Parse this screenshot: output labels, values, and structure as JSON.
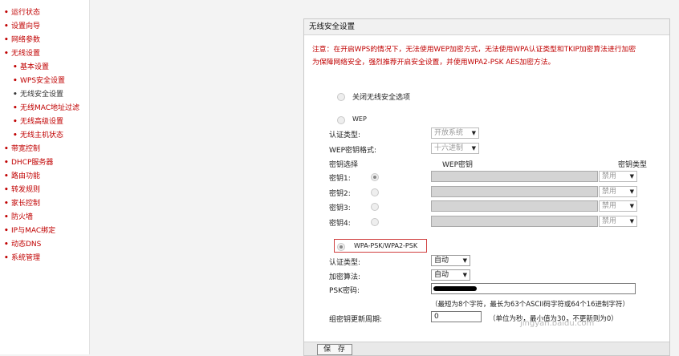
{
  "sidebar": {
    "items": [
      {
        "label": "运行状态",
        "level": "top"
      },
      {
        "label": "设置向导",
        "level": "top"
      },
      {
        "label": "网络参数",
        "level": "top"
      },
      {
        "label": "无线设置",
        "level": "top"
      },
      {
        "label": "基本设置",
        "level": "sub"
      },
      {
        "label": "WPS安全设置",
        "level": "sub"
      },
      {
        "label": "无线安全设置",
        "level": "sub",
        "active": true
      },
      {
        "label": "无线MAC地址过滤",
        "level": "sub"
      },
      {
        "label": "无线高级设置",
        "level": "sub"
      },
      {
        "label": "无线主机状态",
        "level": "sub"
      },
      {
        "label": "带宽控制",
        "level": "top"
      },
      {
        "label": "DHCP服务器",
        "level": "top"
      },
      {
        "label": "路由功能",
        "level": "top"
      },
      {
        "label": "转发规则",
        "level": "top"
      },
      {
        "label": "家长控制",
        "level": "top"
      },
      {
        "label": "防火墙",
        "level": "top"
      },
      {
        "label": "IP与MAC绑定",
        "level": "top"
      },
      {
        "label": "动态DNS",
        "level": "top"
      },
      {
        "label": "系统管理",
        "level": "top"
      }
    ]
  },
  "panel": {
    "title": "无线安全设置",
    "notice_line1": "注意：在开启WPS的情况下，无法使用WEP加密方式，无法使用WPA认证类型和TKIP加密算法进行加密",
    "notice_line2": "为保障网络安全，强烈推荐开启安全设置，并使用WPA2-PSK AES加密方法。"
  },
  "off_option": {
    "label": "关闭无线安全选项"
  },
  "wep": {
    "label": "WEP",
    "auth_label": "认证类型:",
    "auth_value": "开放系统",
    "format_label": "WEP密钥格式:",
    "format_value": "十六进制",
    "key_select_header": "密钥选择",
    "key_header": "WEP密钥",
    "key_type_header": "密钥类型",
    "keys": [
      {
        "label": "密钥1:",
        "type": "禁用"
      },
      {
        "label": "密钥2:",
        "type": "禁用"
      },
      {
        "label": "密钥3:",
        "type": "禁用"
      },
      {
        "label": "密钥4:",
        "type": "禁用"
      }
    ]
  },
  "wpa": {
    "label": "WPA-PSK/WPA2-PSK",
    "auth_label": "认证类型:",
    "auth_value": "自动",
    "alg_label": "加密算法:",
    "alg_value": "自动",
    "psk_label": "PSK密码:",
    "psk_hint": "（最短为8个字符，最长为63个ASCII码字符或64个16进制字符）",
    "renew_label": "组密钥更新周期:",
    "renew_value": "0",
    "renew_hint": "（单位为秒，最小值为30，不更新则为0）"
  },
  "save_label": "保 存",
  "watermark": "jingyan.baidu.com"
}
